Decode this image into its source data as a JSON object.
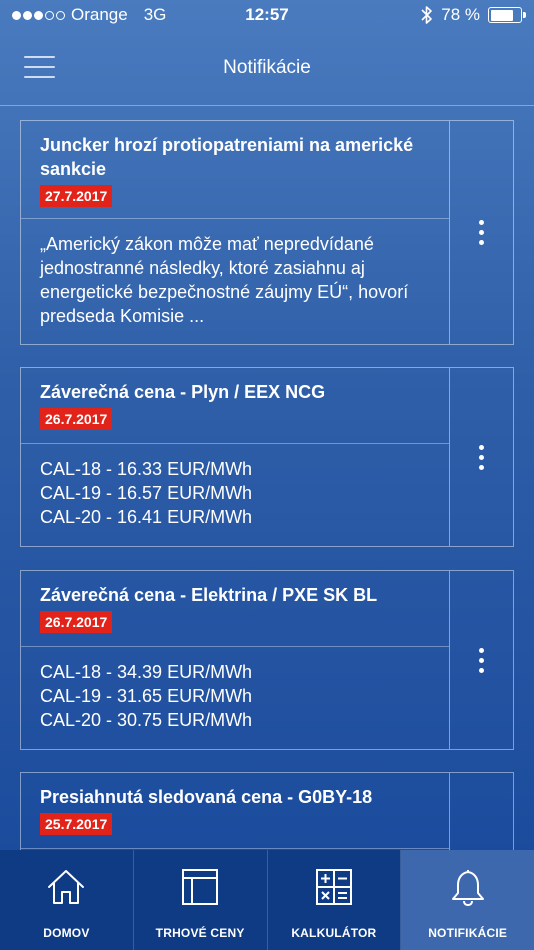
{
  "status": {
    "carrier": "Orange",
    "network": "3G",
    "time": "12:57",
    "battery": "78 %",
    "battery_level": 0.78,
    "signal_bars": 3,
    "signal_total": 5
  },
  "header": {
    "title": "Notifikácie"
  },
  "notifications": [
    {
      "title": "Juncker hrozí protiopatreniami na americké sankcie",
      "date": "27.7.2017",
      "body": "„Americký zákon môže mať nepredvídané jednostranné následky, ktoré zasiahnu aj energetické bezpečnostné záujmy EÚ“, hovorí predseda Komisie ..."
    },
    {
      "title": "Záverečná cena - Plyn / EEX NCG",
      "date": "26.7.2017",
      "lines": [
        "CAL-18 - 16.33 EUR/MWh",
        "CAL-19 - 16.57 EUR/MWh",
        "CAL-20 - 16.41 EUR/MWh"
      ]
    },
    {
      "title": "Záverečná cena - Elektrina / PXE SK BL",
      "date": "26.7.2017",
      "lines": [
        "CAL-18 - 34.39 EUR/MWh",
        "CAL-19 - 31.65 EUR/MWh",
        "CAL-20 - 30.75 EUR/MWh"
      ]
    },
    {
      "title": "Presiahnutá sledovaná cena - G0BY-18",
      "date": "25.7.2017"
    }
  ],
  "tabs": [
    {
      "label": "DOMOV",
      "icon": "home-icon"
    },
    {
      "label": "TRHOVÉ CENY",
      "icon": "market-prices-icon"
    },
    {
      "label": "KALKULÁTOR",
      "icon": "calculator-icon"
    },
    {
      "label": "NOTIFIKÁCIE",
      "icon": "bell-icon",
      "active": true
    }
  ],
  "colors": {
    "date_badge": "#e2231a",
    "tab_bar": "#0f3b85",
    "tab_active": "#3e68ad"
  }
}
